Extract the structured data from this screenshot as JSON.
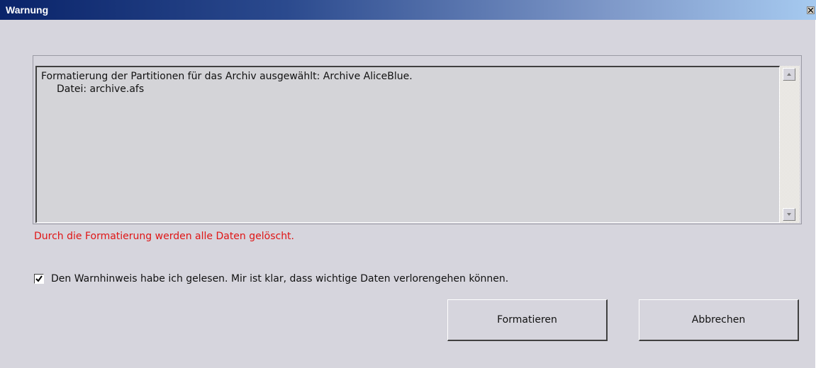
{
  "window": {
    "title": "Warnung"
  },
  "message": {
    "line1": "Formatierung der Partitionen für das Archiv ausgewählt: Archive AliceBlue.",
    "line2": "Datei: archive.afs"
  },
  "warning": {
    "text": "Durch die Formatierung werden alle Daten gelöscht.",
    "color": "#e01515"
  },
  "confirm": {
    "checked": true,
    "label": "Den Warnhinweis habe ich gelesen. Mir ist klar, dass wichtige Daten verlorengehen können."
  },
  "buttons": {
    "format_label": "Formatieren",
    "cancel_label": "Abbrechen"
  },
  "icons": {
    "close": "close-icon",
    "scroll_up": "arrow-up-icon",
    "scroll_down": "arrow-down-icon",
    "check": "checkmark-icon"
  }
}
